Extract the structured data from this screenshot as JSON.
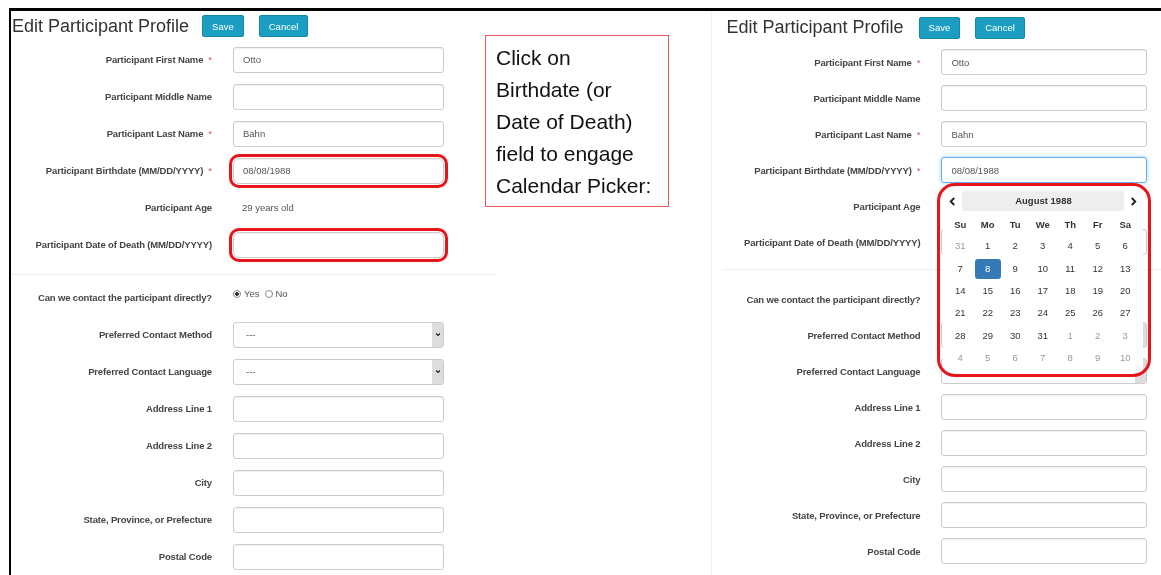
{
  "left_form": {
    "title": "Edit Participant Profile",
    "buttons": [
      {
        "label": "Save"
      },
      {
        "label": "Cancel"
      }
    ],
    "sections": [
      {
        "rows": [
          {
            "kind": "text",
            "label": "Participant First Name",
            "required_mark": "*",
            "value": "Otto",
            "highlighted": false,
            "focused": false
          },
          {
            "kind": "text",
            "label": "Participant Middle Name",
            "highlighted": false,
            "focused": false
          },
          {
            "kind": "text",
            "label": "Participant Last Name",
            "required_mark": "*",
            "value": "Bahn",
            "highlighted": false,
            "focused": false
          },
          {
            "kind": "text",
            "label": "Participant Birthdate (MM/DD/YYYY)",
            "required_mark": "*",
            "value": "08/08/1988",
            "highlighted": true,
            "focused": false
          },
          {
            "kind": "static",
            "label": "Participant Age",
            "value": "29 years old"
          },
          {
            "kind": "text",
            "label": "Participant Date of Death (MM/DD/YYYY)",
            "highlighted": true,
            "focused": false
          }
        ]
      },
      {
        "rows": [
          {
            "kind": "radio",
            "label": "Can we contact the participant directly?",
            "options": [
              {
                "label": "Yes",
                "selected": true
              },
              {
                "label": "No",
                "selected": false
              }
            ]
          },
          {
            "kind": "select",
            "label": "Preferred Contact Method",
            "value": "---"
          },
          {
            "kind": "select",
            "label": "Preferred Contact Language",
            "value": "---"
          },
          {
            "kind": "text",
            "label": "Address Line 1",
            "highlighted": false,
            "focused": false
          },
          {
            "kind": "text",
            "label": "Address Line 2",
            "highlighted": false,
            "focused": false
          },
          {
            "kind": "text",
            "label": "City",
            "highlighted": false,
            "focused": false
          },
          {
            "kind": "text",
            "label": "State, Province, or Prefecture",
            "highlighted": false,
            "focused": false
          },
          {
            "kind": "text",
            "label": "Postal Code",
            "highlighted": false,
            "focused": false
          }
        ]
      }
    ]
  },
  "callout": {
    "text": "Click on Birthdate (or Date of Death) field to engage Calendar Picker:"
  },
  "right_form": {
    "title": "Edit Participant Profile",
    "buttons": [
      {
        "label": "Save"
      },
      {
        "label": "Cancel"
      }
    ],
    "sections": [
      {
        "rows": [
          {
            "kind": "text",
            "label": "Participant First Name",
            "required_mark": "*",
            "value": "Otto",
            "highlighted": false,
            "focused": false
          },
          {
            "kind": "text",
            "label": "Participant Middle Name",
            "highlighted": false,
            "focused": false
          },
          {
            "kind": "text",
            "label": "Participant Last Name",
            "required_mark": "*",
            "value": "Bahn",
            "highlighted": false,
            "focused": false
          },
          {
            "kind": "text",
            "label": "Participant Birthdate (MM/DD/YYYY)",
            "required_mark": "*",
            "value": "08/08/1988",
            "highlighted": false,
            "focused": true
          },
          {
            "kind": "static",
            "label": "Participant Age"
          },
          {
            "kind": "text",
            "label": "Participant Date of Death (MM/DD/YYYY)",
            "highlighted": false,
            "focused": false
          }
        ]
      },
      {
        "rows": [
          {
            "kind": "radio",
            "label": "Can we contact the participant directly?"
          },
          {
            "kind": "select",
            "label": "Preferred Contact Method"
          },
          {
            "kind": "select",
            "label": "Preferred Contact Language"
          },
          {
            "kind": "text",
            "label": "Address Line 1",
            "highlighted": false,
            "focused": false
          },
          {
            "kind": "text",
            "label": "Address Line 2",
            "highlighted": false,
            "focused": false
          },
          {
            "kind": "text",
            "label": "City",
            "highlighted": false,
            "focused": false
          },
          {
            "kind": "text",
            "label": "State, Province, or Prefecture",
            "highlighted": false,
            "focused": false
          },
          {
            "kind": "text",
            "label": "Postal Code",
            "highlighted": false,
            "focused": false
          }
        ]
      }
    ],
    "calendar": {
      "month_label": "August 1988",
      "highlighted": true,
      "weekdays": [
        "Su",
        "Mo",
        "Tu",
        "We",
        "Th",
        "Fr",
        "Sa"
      ],
      "weeks": [
        [
          {
            "day": "31",
            "muted": true,
            "selected": false
          },
          {
            "day": "1",
            "muted": false,
            "selected": false
          },
          {
            "day": "2",
            "muted": false,
            "selected": false
          },
          {
            "day": "3",
            "muted": false,
            "selected": false
          },
          {
            "day": "4",
            "muted": false,
            "selected": false
          },
          {
            "day": "5",
            "muted": false,
            "selected": false
          },
          {
            "day": "6",
            "muted": false,
            "selected": false
          }
        ],
        [
          {
            "day": "7",
            "muted": false,
            "selected": false
          },
          {
            "day": "8",
            "muted": false,
            "selected": true
          },
          {
            "day": "9",
            "muted": false,
            "selected": false
          },
          {
            "day": "10",
            "muted": false,
            "selected": false
          },
          {
            "day": "11",
            "muted": false,
            "selected": false
          },
          {
            "day": "12",
            "muted": false,
            "selected": false
          },
          {
            "day": "13",
            "muted": false,
            "selected": false
          }
        ],
        [
          {
            "day": "14",
            "muted": false,
            "selected": false
          },
          {
            "day": "15",
            "muted": false,
            "selected": false
          },
          {
            "day": "16",
            "muted": false,
            "selected": false
          },
          {
            "day": "17",
            "muted": false,
            "selected": false
          },
          {
            "day": "18",
            "muted": false,
            "selected": false
          },
          {
            "day": "19",
            "muted": false,
            "selected": false
          },
          {
            "day": "20",
            "muted": false,
            "selected": false
          }
        ],
        [
          {
            "day": "21",
            "muted": false,
            "selected": false
          },
          {
            "day": "22",
            "muted": false,
            "selected": false
          },
          {
            "day": "23",
            "muted": false,
            "selected": false
          },
          {
            "day": "24",
            "muted": false,
            "selected": false
          },
          {
            "day": "25",
            "muted": false,
            "selected": false
          },
          {
            "day": "26",
            "muted": false,
            "selected": false
          },
          {
            "day": "27",
            "muted": false,
            "selected": false
          }
        ],
        [
          {
            "day": "28",
            "muted": false,
            "selected": false
          },
          {
            "day": "29",
            "muted": false,
            "selected": false
          },
          {
            "day": "30",
            "muted": false,
            "selected": false
          },
          {
            "day": "31",
            "muted": false,
            "selected": false
          },
          {
            "day": "1",
            "muted": true,
            "selected": false
          },
          {
            "day": "2",
            "muted": true,
            "selected": false
          },
          {
            "day": "3",
            "muted": true,
            "selected": false
          }
        ],
        [
          {
            "day": "4",
            "muted": true,
            "selected": false
          },
          {
            "day": "5",
            "muted": true,
            "selected": false
          },
          {
            "day": "6",
            "muted": true,
            "selected": false
          },
          {
            "day": "7",
            "muted": true,
            "selected": false
          },
          {
            "day": "8",
            "muted": true,
            "selected": false
          },
          {
            "day": "9",
            "muted": true,
            "selected": false
          },
          {
            "day": "10",
            "muted": true,
            "selected": false
          }
        ]
      ]
    }
  }
}
